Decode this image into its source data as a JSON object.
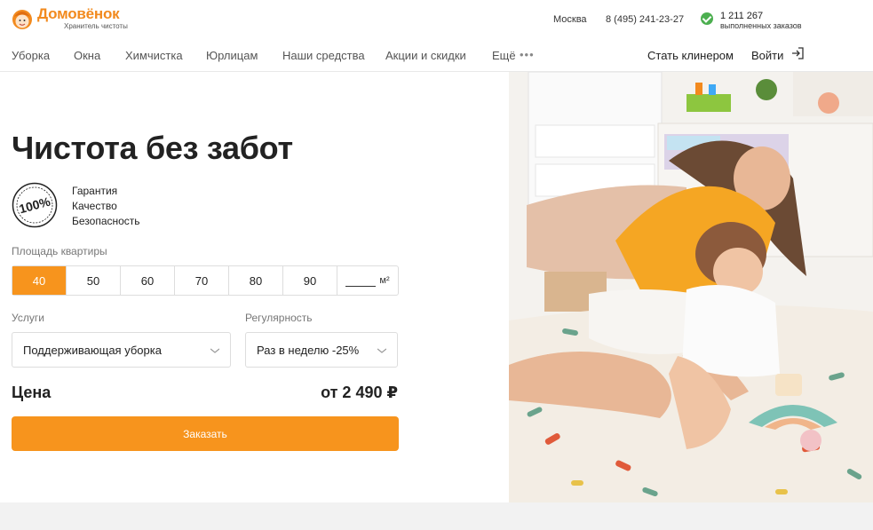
{
  "header": {
    "logo_name": "Домовёнок",
    "logo_tagline": "Хранитель чистоты",
    "city": "Москва",
    "phone": "8 (495) 241-23-27",
    "orders_count": "1 211 267",
    "orders_label": "выполненных заказов"
  },
  "nav": {
    "items": [
      "Уборка",
      "Окна",
      "Химчистка",
      "Юрлицам",
      "Наши средства",
      "Акции и скидки",
      "Ещё"
    ],
    "more_dots": "•••",
    "become_cleaner": "Стать клинером",
    "login": "Войти"
  },
  "hero": {
    "title": "Чистота без забот",
    "badge_text": "100%",
    "features": [
      "Гарантия",
      "Качество",
      "Безопасность"
    ]
  },
  "calculator": {
    "area_label": "Площадь квартиры",
    "areas": [
      "40",
      "50",
      "60",
      "70",
      "80",
      "90"
    ],
    "active_area": "40",
    "custom_unit": "м²",
    "services_label": "Услуги",
    "services_value": "Поддерживающая уборка",
    "regularity_label": "Регулярность",
    "regularity_value": "Раз в неделю -25%",
    "price_label": "Цена",
    "price_value": "от 2 490 ₽",
    "order_button": "Заказать"
  },
  "colors": {
    "accent": "#f7941d",
    "check": "#4caf50"
  }
}
